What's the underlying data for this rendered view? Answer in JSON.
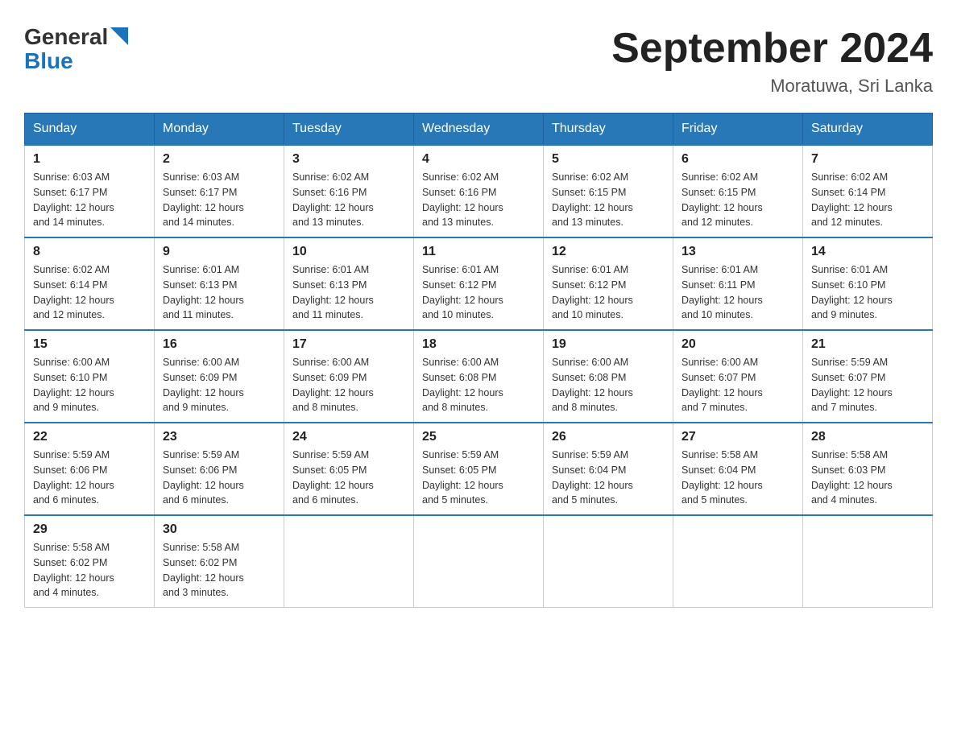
{
  "header": {
    "logo_text_general": "General",
    "logo_text_blue": "Blue",
    "title": "September 2024",
    "subtitle": "Moratuwa, Sri Lanka"
  },
  "weekdays": [
    "Sunday",
    "Monday",
    "Tuesday",
    "Wednesday",
    "Thursday",
    "Friday",
    "Saturday"
  ],
  "weeks": [
    [
      {
        "day": "1",
        "sunrise": "6:03 AM",
        "sunset": "6:17 PM",
        "daylight": "12 hours and 14 minutes."
      },
      {
        "day": "2",
        "sunrise": "6:03 AM",
        "sunset": "6:17 PM",
        "daylight": "12 hours and 14 minutes."
      },
      {
        "day": "3",
        "sunrise": "6:02 AM",
        "sunset": "6:16 PM",
        "daylight": "12 hours and 13 minutes."
      },
      {
        "day": "4",
        "sunrise": "6:02 AM",
        "sunset": "6:16 PM",
        "daylight": "12 hours and 13 minutes."
      },
      {
        "day": "5",
        "sunrise": "6:02 AM",
        "sunset": "6:15 PM",
        "daylight": "12 hours and 13 minutes."
      },
      {
        "day": "6",
        "sunrise": "6:02 AM",
        "sunset": "6:15 PM",
        "daylight": "12 hours and 12 minutes."
      },
      {
        "day": "7",
        "sunrise": "6:02 AM",
        "sunset": "6:14 PM",
        "daylight": "12 hours and 12 minutes."
      }
    ],
    [
      {
        "day": "8",
        "sunrise": "6:02 AM",
        "sunset": "6:14 PM",
        "daylight": "12 hours and 12 minutes."
      },
      {
        "day": "9",
        "sunrise": "6:01 AM",
        "sunset": "6:13 PM",
        "daylight": "12 hours and 11 minutes."
      },
      {
        "day": "10",
        "sunrise": "6:01 AM",
        "sunset": "6:13 PM",
        "daylight": "12 hours and 11 minutes."
      },
      {
        "day": "11",
        "sunrise": "6:01 AM",
        "sunset": "6:12 PM",
        "daylight": "12 hours and 10 minutes."
      },
      {
        "day": "12",
        "sunrise": "6:01 AM",
        "sunset": "6:12 PM",
        "daylight": "12 hours and 10 minutes."
      },
      {
        "day": "13",
        "sunrise": "6:01 AM",
        "sunset": "6:11 PM",
        "daylight": "12 hours and 10 minutes."
      },
      {
        "day": "14",
        "sunrise": "6:01 AM",
        "sunset": "6:10 PM",
        "daylight": "12 hours and 9 minutes."
      }
    ],
    [
      {
        "day": "15",
        "sunrise": "6:00 AM",
        "sunset": "6:10 PM",
        "daylight": "12 hours and 9 minutes."
      },
      {
        "day": "16",
        "sunrise": "6:00 AM",
        "sunset": "6:09 PM",
        "daylight": "12 hours and 9 minutes."
      },
      {
        "day": "17",
        "sunrise": "6:00 AM",
        "sunset": "6:09 PM",
        "daylight": "12 hours and 8 minutes."
      },
      {
        "day": "18",
        "sunrise": "6:00 AM",
        "sunset": "6:08 PM",
        "daylight": "12 hours and 8 minutes."
      },
      {
        "day": "19",
        "sunrise": "6:00 AM",
        "sunset": "6:08 PM",
        "daylight": "12 hours and 8 minutes."
      },
      {
        "day": "20",
        "sunrise": "6:00 AM",
        "sunset": "6:07 PM",
        "daylight": "12 hours and 7 minutes."
      },
      {
        "day": "21",
        "sunrise": "5:59 AM",
        "sunset": "6:07 PM",
        "daylight": "12 hours and 7 minutes."
      }
    ],
    [
      {
        "day": "22",
        "sunrise": "5:59 AM",
        "sunset": "6:06 PM",
        "daylight": "12 hours and 6 minutes."
      },
      {
        "day": "23",
        "sunrise": "5:59 AM",
        "sunset": "6:06 PM",
        "daylight": "12 hours and 6 minutes."
      },
      {
        "day": "24",
        "sunrise": "5:59 AM",
        "sunset": "6:05 PM",
        "daylight": "12 hours and 6 minutes."
      },
      {
        "day": "25",
        "sunrise": "5:59 AM",
        "sunset": "6:05 PM",
        "daylight": "12 hours and 5 minutes."
      },
      {
        "day": "26",
        "sunrise": "5:59 AM",
        "sunset": "6:04 PM",
        "daylight": "12 hours and 5 minutes."
      },
      {
        "day": "27",
        "sunrise": "5:58 AM",
        "sunset": "6:04 PM",
        "daylight": "12 hours and 5 minutes."
      },
      {
        "day": "28",
        "sunrise": "5:58 AM",
        "sunset": "6:03 PM",
        "daylight": "12 hours and 4 minutes."
      }
    ],
    [
      {
        "day": "29",
        "sunrise": "5:58 AM",
        "sunset": "6:02 PM",
        "daylight": "12 hours and 4 minutes."
      },
      {
        "day": "30",
        "sunrise": "5:58 AM",
        "sunset": "6:02 PM",
        "daylight": "12 hours and 3 minutes."
      },
      null,
      null,
      null,
      null,
      null
    ]
  ],
  "labels": {
    "sunrise": "Sunrise:",
    "sunset": "Sunset:",
    "daylight": "Daylight:"
  }
}
